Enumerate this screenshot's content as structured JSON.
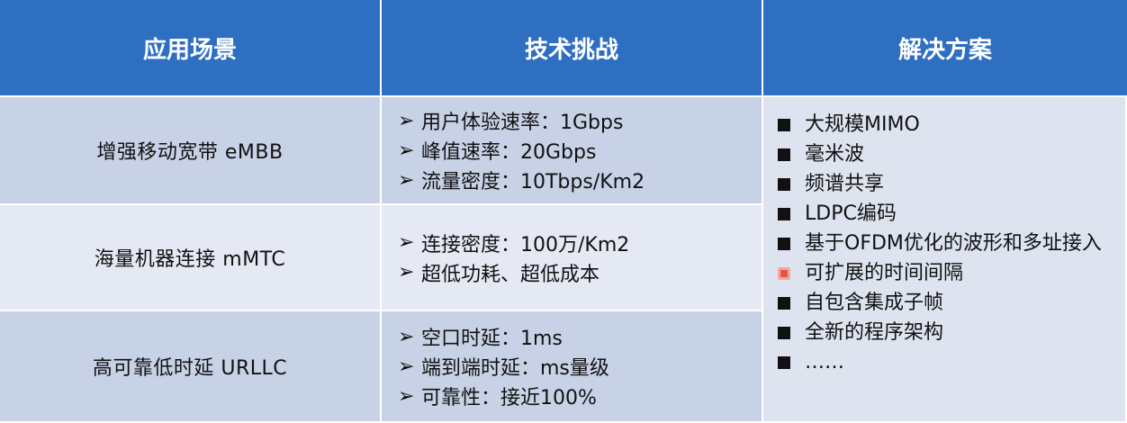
{
  "headers": {
    "scenario": "应用场景",
    "challenge": "技术挑战",
    "solution": "解决方案"
  },
  "rows": [
    {
      "scenario": "增强移动宽带  eMBB",
      "challenges": [
        "用户体验速率：1Gbps",
        "峰值速率：20Gbps",
        "流量密度：10Tbps/Km2"
      ]
    },
    {
      "scenario": "海量机器连接  mMTC",
      "challenges": [
        "连接密度：100万/Km2",
        "超低功耗、超低成本"
      ]
    },
    {
      "scenario": "高可靠低时延  URLLC",
      "challenges": [
        "空口时延：1ms",
        "端到端时延：ms量级",
        "可靠性：接近100%"
      ]
    }
  ],
  "solutions": [
    "大规模MIMO",
    "毫米波",
    "频谱共享",
    "LDPC编码",
    "基于OFDM优化的波形和多址接入",
    "可扩展的时间间隔",
    "自包含集成子帧",
    "全新的程序架构",
    "……"
  ],
  "colors": {
    "header_bg": "#2f6fc2",
    "row_dark": "#c8d2e6",
    "row_light": "#e4e9f3",
    "cursor_marker": "#e3574a"
  },
  "icons": {
    "challenge_bullet": "arrow-right-icon",
    "solution_bullet": "square-bullet-icon"
  }
}
